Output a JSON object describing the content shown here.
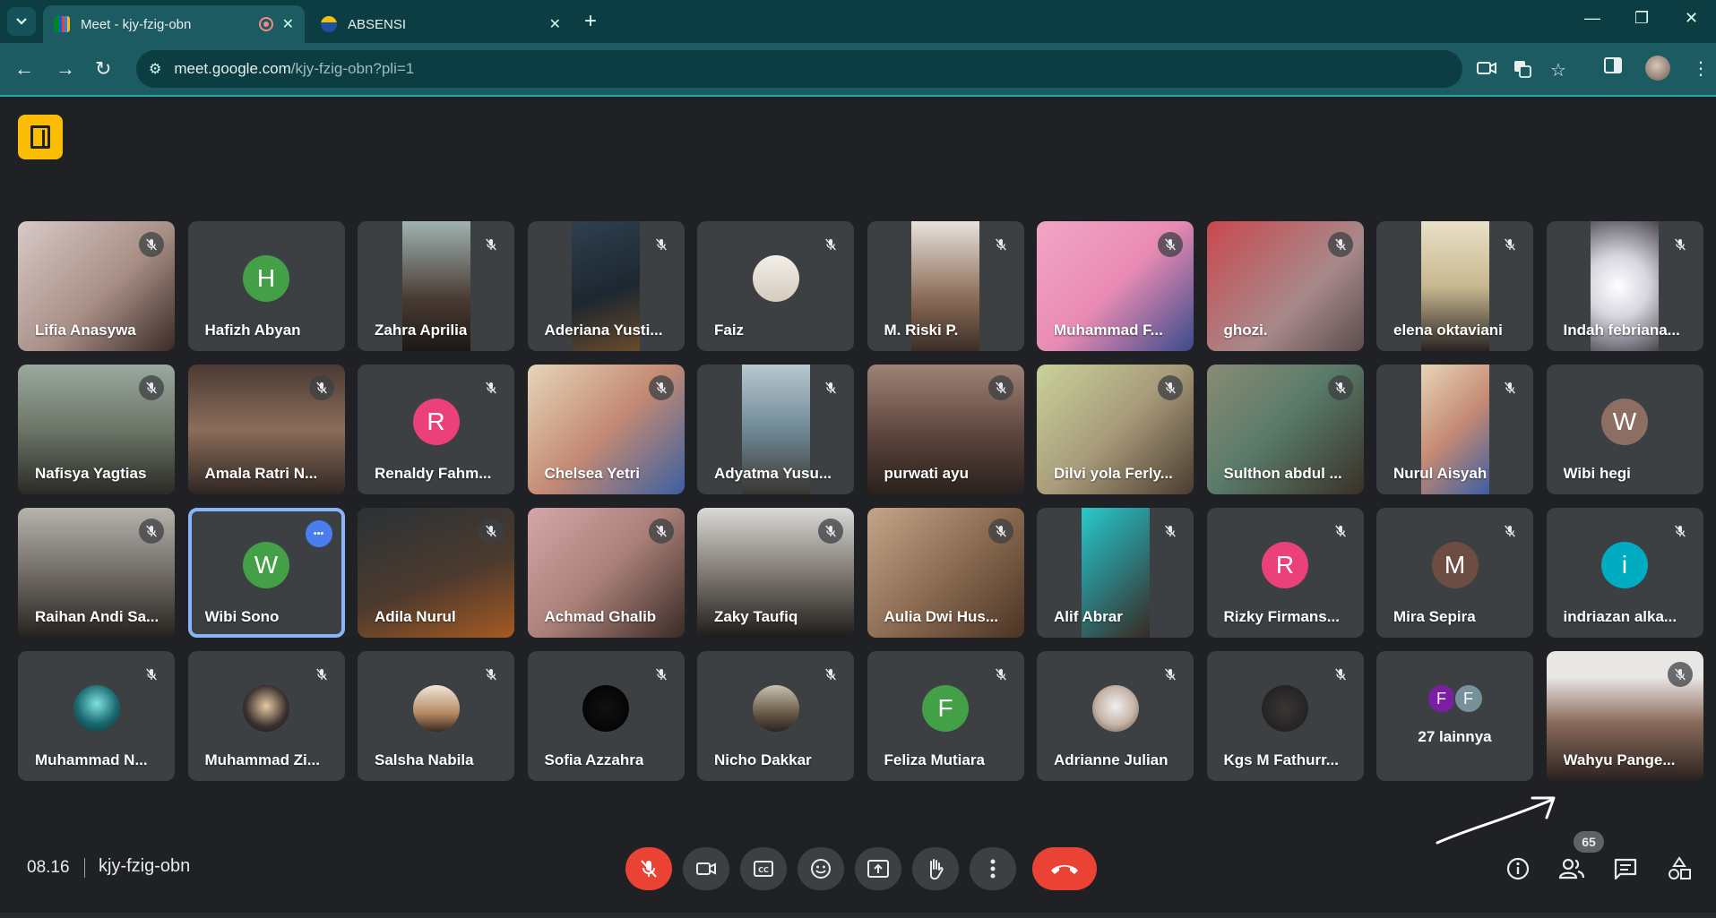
{
  "browser": {
    "tabs": [
      {
        "title": "Meet - kjy-fzig-obn",
        "favicon": "google-meet-icon",
        "recording": true
      },
      {
        "title": "ABSENSI",
        "favicon": "school-crest-icon"
      }
    ],
    "url_host": "meet.google.com",
    "url_path": "/kjy-fzig-obn?pli=1"
  },
  "colors": {
    "accent": "#8ab4f8",
    "end_call": "#ea4335",
    "meet_logo": "#fbbc04",
    "chrome_bar": "#1b5b61"
  },
  "participants": [
    {
      "name": "Lifia Anasywa",
      "kind": "video",
      "bg": "linear-gradient(135deg,#d8c9c7,#a88f86 55%,#3b2b28)",
      "muted": true
    },
    {
      "name": "Hafizh Abyan",
      "kind": "avatar",
      "initial": "H",
      "color": "#43a047",
      "muted": false
    },
    {
      "name": "Zahra Aprilia",
      "kind": "video",
      "narrow": true,
      "bg": "linear-gradient(180deg,#9fb3b1,#4a3b33 60%,#1c1816)",
      "muted": true
    },
    {
      "name": "Aderiana Yusti...",
      "kind": "video",
      "narrow": true,
      "bg": "linear-gradient(160deg,#304050,#1c2730 55%,#6a4b2a)",
      "muted": true
    },
    {
      "name": "Faiz",
      "kind": "avatar-photo",
      "photo": "linear-gradient(180deg,#f2efe8,#d6cbbd)",
      "muted": true
    },
    {
      "name": "M. Riski P.",
      "kind": "video",
      "narrow": true,
      "bg": "linear-gradient(180deg,#e7e2dc,#8a6a55 60%,#3b2f28)",
      "muted": true
    },
    {
      "name": "Muhammad F...",
      "kind": "video",
      "bg": "linear-gradient(135deg,#f1a6c6,#e98bb3 50%,#3a4a8c)",
      "muted": true
    },
    {
      "name": "ghozi.",
      "kind": "video",
      "bg": "linear-gradient(135deg,#c9484e,#a8898a 60%,#5a4d4c)",
      "muted": true
    },
    {
      "name": "elena oktaviani",
      "kind": "video",
      "narrow": true,
      "bg": "linear-gradient(180deg,#e8e0c8,#c8b890 50%,#2a2422)",
      "muted": true
    },
    {
      "name": "Indah febriana...",
      "kind": "video",
      "narrow": true,
      "bg": "radial-gradient(circle at 40% 50%,#ffffff,#d7d5de 40%,#4a4650)",
      "muted": true
    },
    {
      "name": "Nafisya Yagtias",
      "kind": "video",
      "bg": "linear-gradient(180deg,#9aa89e,#6c7567 50%,#2a2a26)",
      "muted": true
    },
    {
      "name": "Amala Ratri N...",
      "kind": "video",
      "bg": "linear-gradient(180deg,#4b3a33,#8b6d5a 50%,#2f2622)",
      "muted": true
    },
    {
      "name": "Renaldy Fahm...",
      "kind": "avatar",
      "initial": "R",
      "color": "#ec407a",
      "muted": true
    },
    {
      "name": "Chelsea Yetri",
      "kind": "video",
      "bg": "linear-gradient(135deg,#e6d5b8,#c58a73 50%,#3c5fa0)",
      "muted": true
    },
    {
      "name": "Adyatma Yusu...",
      "kind": "video",
      "narrow": true,
      "bg": "linear-gradient(180deg,#b9c7d0,#6f8a96 50%,#3a3630)",
      "muted": true
    },
    {
      "name": "purwati ayu",
      "kind": "video",
      "bg": "linear-gradient(180deg,#a08276,#5a443c 55%,#2a201c)",
      "muted": true
    },
    {
      "name": "Dilvi yola Ferly...",
      "kind": "video",
      "bg": "linear-gradient(135deg,#c9d29a,#a89b7a 50%,#4a3c30)",
      "muted": true
    },
    {
      "name": "Sulthon abdul ...",
      "kind": "video",
      "bg": "linear-gradient(135deg,#8a8b73,#5a7c6a 45%,#3a3028)",
      "muted": true
    },
    {
      "name": "Nurul Aisyah",
      "kind": "video",
      "narrow": true,
      "bg": "linear-gradient(135deg,#e6d5b8,#c58a73 50%,#3c5fa0)",
      "muted": true
    },
    {
      "name": "Wibi hegi",
      "kind": "avatar",
      "initial": "W",
      "color": "#8d6e63",
      "muted": false
    },
    {
      "name": "Raihan Andi Sa...",
      "kind": "video",
      "bg": "linear-gradient(180deg,#b6b3ad,#6a6560 55%,#25221f)",
      "muted": true
    },
    {
      "name": "Wibi Sono",
      "kind": "avatar",
      "initial": "W",
      "color": "#43a047",
      "muted": false,
      "selected": true
    },
    {
      "name": "Adila Nurul",
      "kind": "video",
      "bg": "linear-gradient(160deg,#2a3236,#4c3a2e 55%,#a55a22)",
      "muted": true
    },
    {
      "name": "Achmad Ghalib",
      "kind": "video",
      "bg": "linear-gradient(135deg,#d4a6a8,#a98078 50%,#3a2b26)",
      "muted": true
    },
    {
      "name": "Zaky Taufiq",
      "kind": "video",
      "bg": "linear-gradient(180deg,#d9d9d6,#7f7a72 50%,#1e1c1a)",
      "muted": true
    },
    {
      "name": "Aulia Dwi Hus...",
      "kind": "video",
      "bg": "linear-gradient(135deg,#c3a68a,#8c6c52 50%,#4a3424)",
      "muted": true
    },
    {
      "name": "Alif Abrar",
      "kind": "video",
      "narrow": true,
      "bg": "linear-gradient(135deg,#2ac9c9,#2a8a8e 40%,#3a2a22)",
      "muted": true
    },
    {
      "name": "Rizky Firmans...",
      "kind": "avatar",
      "initial": "R",
      "color": "#ec407a",
      "muted": true
    },
    {
      "name": "Mira Sepira",
      "kind": "avatar",
      "initial": "M",
      "color": "#6d4c41",
      "muted": true
    },
    {
      "name": "indriazan alka...",
      "kind": "avatar",
      "initial": "i",
      "color": "#00acc1",
      "muted": true
    },
    {
      "name": "Muhammad N...",
      "kind": "avatar-photo",
      "photo": "radial-gradient(circle at 50% 40%,#7fe0e0,#1a6a70 55%,#0d2a30)",
      "muted": true
    },
    {
      "name": "Muhammad Zi...",
      "kind": "avatar-photo",
      "photo": "radial-gradient(circle at 50% 45%,#e8c9a0,#3a3030 60%,#151515)",
      "muted": true
    },
    {
      "name": "Salsha Nabila",
      "kind": "avatar-photo",
      "photo": "linear-gradient(180deg,#f0e6d8,#b58a63 60%,#3a2a20)",
      "muted": true
    },
    {
      "name": "Sofia Azzahra",
      "kind": "avatar-photo",
      "photo": "radial-gradient(circle,#111111,#000000)",
      "muted": true
    },
    {
      "name": "Nicho Dakkar",
      "kind": "avatar-photo",
      "photo": "linear-gradient(180deg,#c8c0b0,#6a5a48 60%,#2a2420)",
      "muted": true
    },
    {
      "name": "Feliza Mutiara",
      "kind": "avatar",
      "initial": "F",
      "color": "#43a047",
      "muted": true
    },
    {
      "name": "Adrianne Julian",
      "kind": "avatar-photo",
      "photo": "radial-gradient(circle at 50% 45%,#f0f0f0,#c6b3a6 55%,#5a4a44)",
      "muted": true
    },
    {
      "name": "Kgs M Fathurr...",
      "kind": "avatar-photo",
      "photo": "radial-gradient(circle,#3a3636,#1c1a1a)",
      "muted": true
    },
    {
      "kind": "others",
      "label": "27 lainnya",
      "initials": [
        {
          "letter": "F",
          "color": "#7b1fa2"
        },
        {
          "letter": "F",
          "color": "#78909c"
        }
      ]
    },
    {
      "name": "Wahyu Pange...",
      "kind": "video",
      "bg": "linear-gradient(180deg,#e9e7e6 20%,#8a6a5a 55%,#2a2220)",
      "muted": true
    }
  ],
  "meeting": {
    "time": "08.16",
    "code": "kjy-fzig-obn",
    "participant_count": "65"
  },
  "controls": [
    "mic-off",
    "camera",
    "captions",
    "reactions",
    "present",
    "raise-hand",
    "more",
    "leave-call"
  ],
  "right_controls": [
    "meeting-info",
    "people",
    "chat",
    "activities"
  ]
}
